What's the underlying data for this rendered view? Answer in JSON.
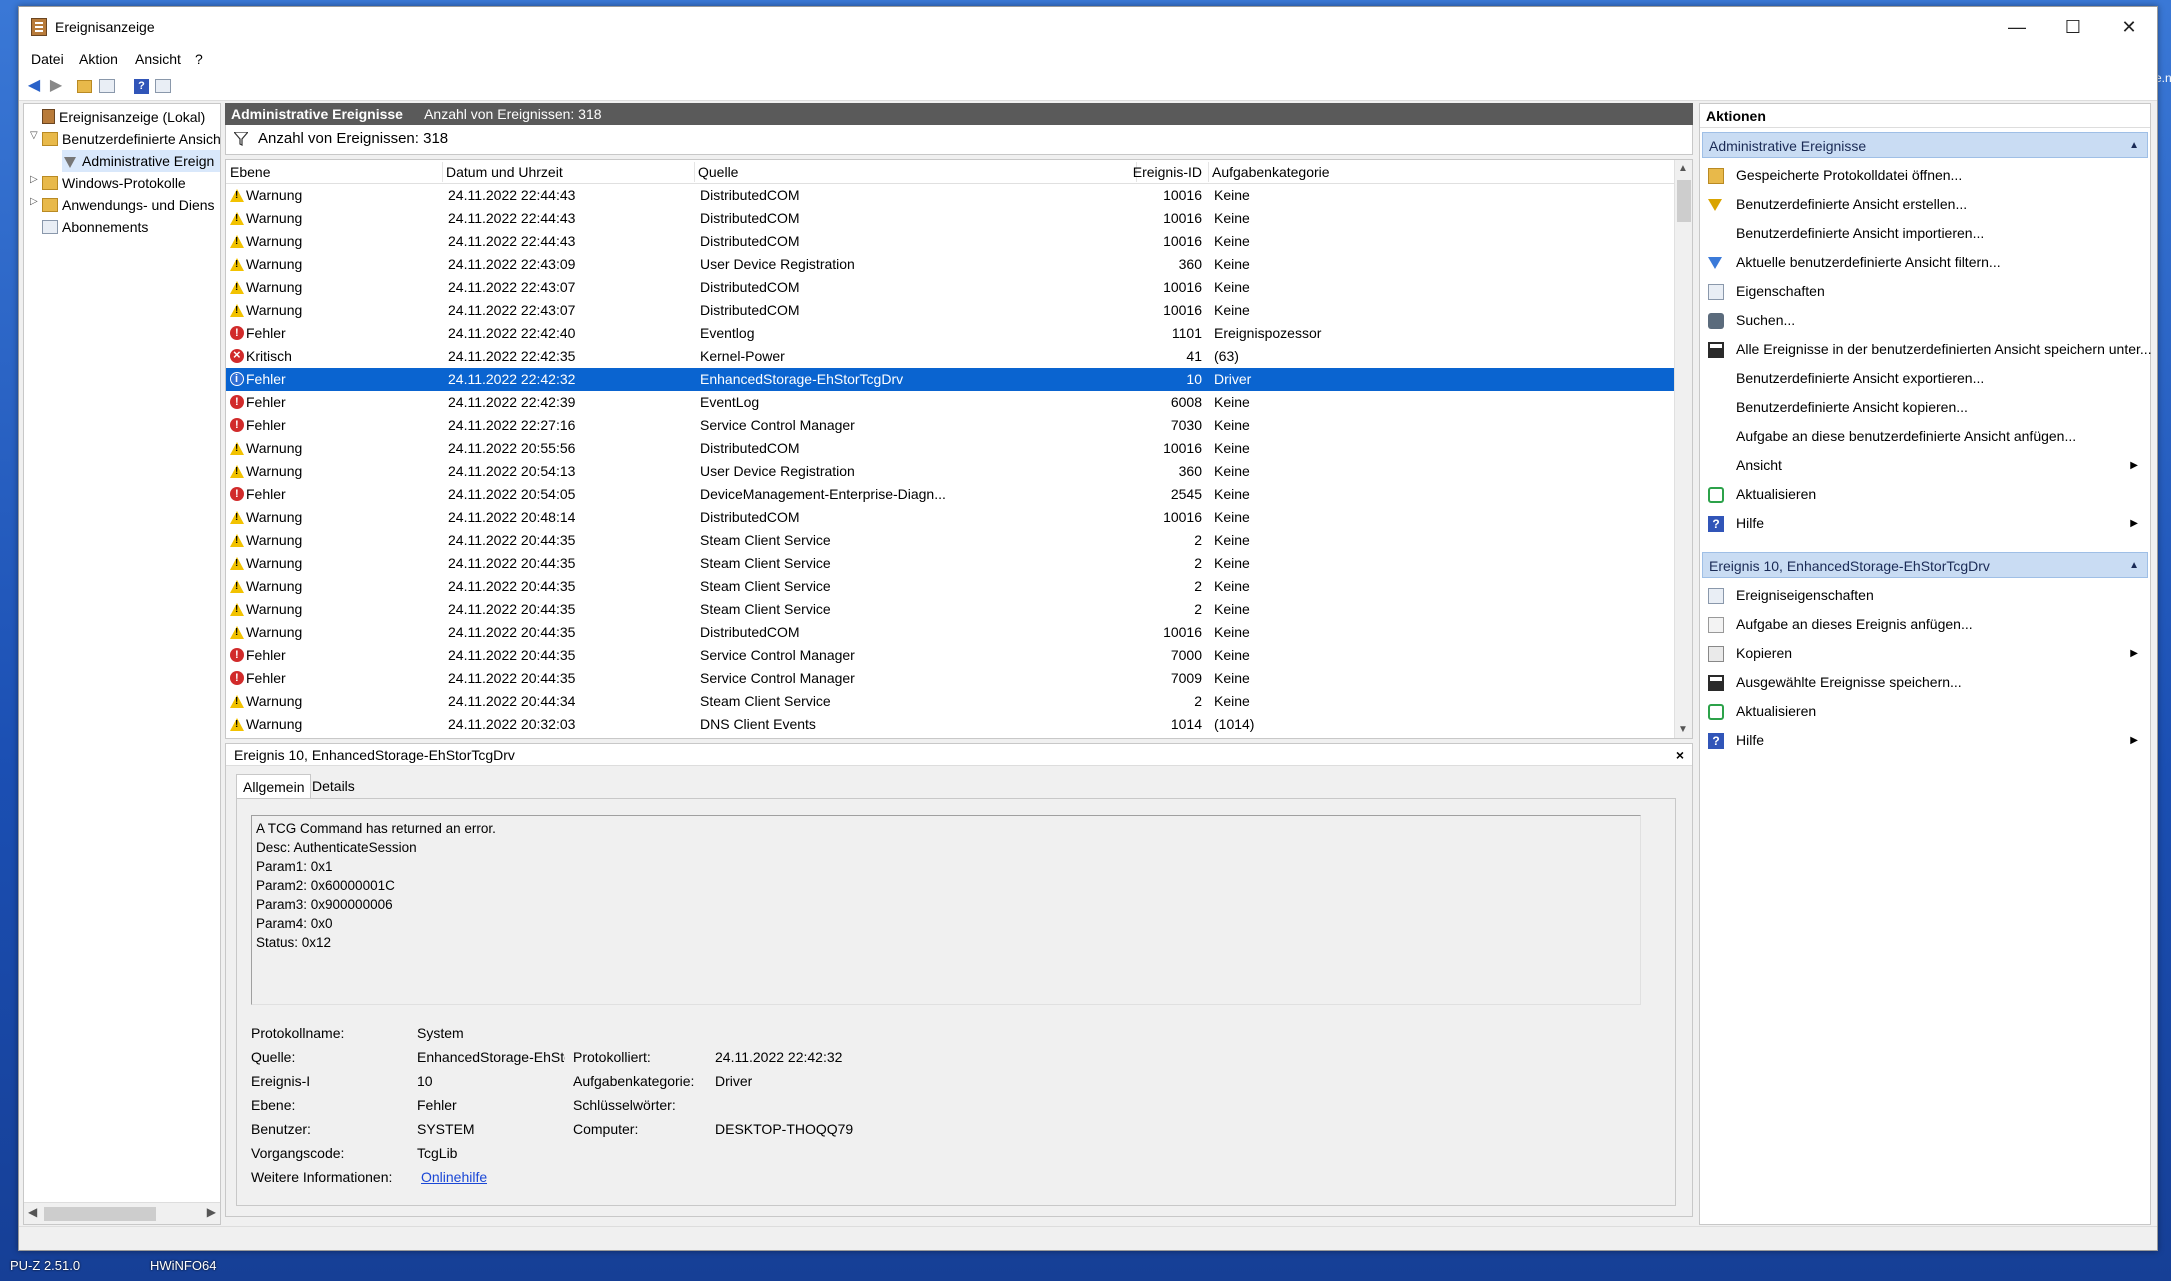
{
  "window": {
    "title": "Ereignisanzeige"
  },
  "menu": [
    "Datei",
    "Aktion",
    "Ansicht",
    "?"
  ],
  "desktop": {
    "right_text": "e.n",
    "taskbar_labels": [
      "PU-Z 2.51.0",
      "HWiNFO64"
    ]
  },
  "tree": {
    "items": [
      {
        "label": "Ereignisanzeige (Lokal)"
      },
      {
        "label": "Benutzerdefinierte Ansicht"
      },
      {
        "label": "Administrative Ereign"
      },
      {
        "label": "Windows-Protokolle"
      },
      {
        "label": "Anwendungs- und Diens"
      },
      {
        "label": "Abonnements"
      }
    ]
  },
  "middle": {
    "header_title": "Administrative Ereignisse",
    "header_count": "Anzahl von Ereignissen: 318",
    "filter_text": "Anzahl von Ereignissen: 318",
    "columns": [
      "Ebene",
      "Datum und Uhrzeit",
      "Quelle",
      "Ereignis-ID",
      "Aufgabenkategorie"
    ],
    "rows": [
      {
        "level": "Warnung",
        "type": "warn",
        "date": "24.11.2022 22:44:43",
        "source": "DistributedCOM",
        "id": "10016",
        "cat": "Keine"
      },
      {
        "level": "Warnung",
        "type": "warn",
        "date": "24.11.2022 22:44:43",
        "source": "DistributedCOM",
        "id": "10016",
        "cat": "Keine"
      },
      {
        "level": "Warnung",
        "type": "warn",
        "date": "24.11.2022 22:44:43",
        "source": "DistributedCOM",
        "id": "10016",
        "cat": "Keine"
      },
      {
        "level": "Warnung",
        "type": "warn",
        "date": "24.11.2022 22:43:09",
        "source": "User Device Registration",
        "id": "360",
        "cat": "Keine"
      },
      {
        "level": "Warnung",
        "type": "warn",
        "date": "24.11.2022 22:43:07",
        "source": "DistributedCOM",
        "id": "10016",
        "cat": "Keine"
      },
      {
        "level": "Warnung",
        "type": "warn",
        "date": "24.11.2022 22:43:07",
        "source": "DistributedCOM",
        "id": "10016",
        "cat": "Keine"
      },
      {
        "level": "Fehler",
        "type": "err",
        "date": "24.11.2022 22:42:40",
        "source": "Eventlog",
        "id": "1101",
        "cat": "Ereignispozessor"
      },
      {
        "level": "Kritisch",
        "type": "crit",
        "date": "24.11.2022 22:42:35",
        "source": "Kernel-Power",
        "id": "41",
        "cat": "(63)"
      },
      {
        "level": "Fehler",
        "type": "info",
        "date": "24.11.2022 22:42:32",
        "source": "EnhancedStorage-EhStorTcgDrv",
        "id": "10",
        "cat": "Driver",
        "selected": true
      },
      {
        "level": "Fehler",
        "type": "err",
        "date": "24.11.2022 22:42:39",
        "source": "EventLog",
        "id": "6008",
        "cat": "Keine"
      },
      {
        "level": "Fehler",
        "type": "err",
        "date": "24.11.2022 22:27:16",
        "source": "Service Control Manager",
        "id": "7030",
        "cat": "Keine"
      },
      {
        "level": "Warnung",
        "type": "warn",
        "date": "24.11.2022 20:55:56",
        "source": "DistributedCOM",
        "id": "10016",
        "cat": "Keine"
      },
      {
        "level": "Warnung",
        "type": "warn",
        "date": "24.11.2022 20:54:13",
        "source": "User Device Registration",
        "id": "360",
        "cat": "Keine"
      },
      {
        "level": "Fehler",
        "type": "err",
        "date": "24.11.2022 20:54:05",
        "source": "DeviceManagement-Enterprise-Diagn...",
        "id": "2545",
        "cat": "Keine"
      },
      {
        "level": "Warnung",
        "type": "warn",
        "date": "24.11.2022 20:48:14",
        "source": "DistributedCOM",
        "id": "10016",
        "cat": "Keine"
      },
      {
        "level": "Warnung",
        "type": "warn",
        "date": "24.11.2022 20:44:35",
        "source": "Steam Client Service",
        "id": "2",
        "cat": "Keine"
      },
      {
        "level": "Warnung",
        "type": "warn",
        "date": "24.11.2022 20:44:35",
        "source": "Steam Client Service",
        "id": "2",
        "cat": "Keine"
      },
      {
        "level": "Warnung",
        "type": "warn",
        "date": "24.11.2022 20:44:35",
        "source": "Steam Client Service",
        "id": "2",
        "cat": "Keine"
      },
      {
        "level": "Warnung",
        "type": "warn",
        "date": "24.11.2022 20:44:35",
        "source": "Steam Client Service",
        "id": "2",
        "cat": "Keine"
      },
      {
        "level": "Warnung",
        "type": "warn",
        "date": "24.11.2022 20:44:35",
        "source": "DistributedCOM",
        "id": "10016",
        "cat": "Keine"
      },
      {
        "level": "Fehler",
        "type": "err",
        "date": "24.11.2022 20:44:35",
        "source": "Service Control Manager",
        "id": "7000",
        "cat": "Keine"
      },
      {
        "level": "Fehler",
        "type": "err",
        "date": "24.11.2022 20:44:35",
        "source": "Service Control Manager",
        "id": "7009",
        "cat": "Keine"
      },
      {
        "level": "Warnung",
        "type": "warn",
        "date": "24.11.2022 20:44:34",
        "source": "Steam Client Service",
        "id": "2",
        "cat": "Keine"
      },
      {
        "level": "Warnung",
        "type": "warn",
        "date": "24.11.2022 20:32:03",
        "source": "DNS Client Events",
        "id": "1014",
        "cat": "(1014)"
      }
    ]
  },
  "detail": {
    "title": "Ereignis 10, EnhancedStorage-EhStorTcgDrv",
    "close": "×",
    "tabs": [
      "Allgemein",
      "Details"
    ],
    "description": [
      "A TCG Command has returned an error.",
      "Desc: AuthenticateSession",
      "Param1: 0x1",
      "Param2: 0x60000001C",
      "Param3: 0x900000006",
      "Param4: 0x0",
      "Status: 0x12"
    ],
    "fields": {
      "log_name_label": "Protokollname:",
      "log_name": "System",
      "source_label": "Quelle:",
      "source": "EnhancedStorage-EhStor",
      "logged_label": "Protokolliert:",
      "logged": "24.11.2022 22:42:32",
      "event_id_label": "Ereignis-I",
      "event_id": "10",
      "task_label": "Aufgabenkategorie:",
      "task": "Driver",
      "level_label": "Ebene:",
      "level": "Fehler",
      "keywords_label": "Schlüsselwörter:",
      "keywords": "",
      "user_label": "Benutzer:",
      "user": "SYSTEM",
      "computer_label": "Computer:",
      "computer": "DESKTOP-THOQQ79",
      "opcode_label": "Vorgangscode:",
      "opcode": "TcgLib",
      "more_info_label": "Weitere Informationen:",
      "more_info_link": "Onlinehilfe"
    }
  },
  "actions": {
    "title": "Aktionen",
    "section1": "Administrative Ereignisse",
    "section1_items": [
      {
        "label": "Gespeicherte Protokolldatei öffnen...",
        "icon": "folder-icon"
      },
      {
        "label": "Benutzerdefinierte Ansicht erstellen...",
        "icon": "funnel-icon"
      },
      {
        "label": "Benutzerdefinierte Ansicht importieren...",
        "icon": ""
      },
      {
        "label": "Aktuelle benutzerdefinierte Ansicht filtern...",
        "icon": "funnel-blue-icon"
      },
      {
        "label": "Eigenschaften",
        "icon": "properties-icon"
      },
      {
        "label": "Suchen...",
        "icon": "find-icon"
      },
      {
        "label": "Alle Ereignisse in der benutzerdefinierten Ansicht speichern unter...",
        "icon": "save-icon"
      },
      {
        "label": "Benutzerdefinierte Ansicht exportieren...",
        "icon": ""
      },
      {
        "label": "Benutzerdefinierte Ansicht kopieren...",
        "icon": ""
      },
      {
        "label": "Aufgabe an diese benutzerdefinierte Ansicht anfügen...",
        "icon": ""
      },
      {
        "label": "Ansicht",
        "icon": "",
        "submenu": true
      },
      {
        "label": "Aktualisieren",
        "icon": "refresh-icon"
      },
      {
        "label": "Hilfe",
        "icon": "help-icon",
        "submenu": true
      }
    ],
    "section2": "Ereignis 10, EnhancedStorage-EhStorTcgDrv",
    "section2_items": [
      {
        "label": "Ereigniseigenschaften",
        "icon": "properties-icon"
      },
      {
        "label": "Aufgabe an dieses Ereignis anfügen...",
        "icon": "attach-icon"
      },
      {
        "label": "Kopieren",
        "icon": "copy-icon",
        "submenu": true
      },
      {
        "label": "Ausgewählte Ereignisse speichern...",
        "icon": "save-icon"
      },
      {
        "label": "Aktualisieren",
        "icon": "refresh-icon"
      },
      {
        "label": "Hilfe",
        "icon": "help-icon",
        "submenu": true
      }
    ]
  }
}
